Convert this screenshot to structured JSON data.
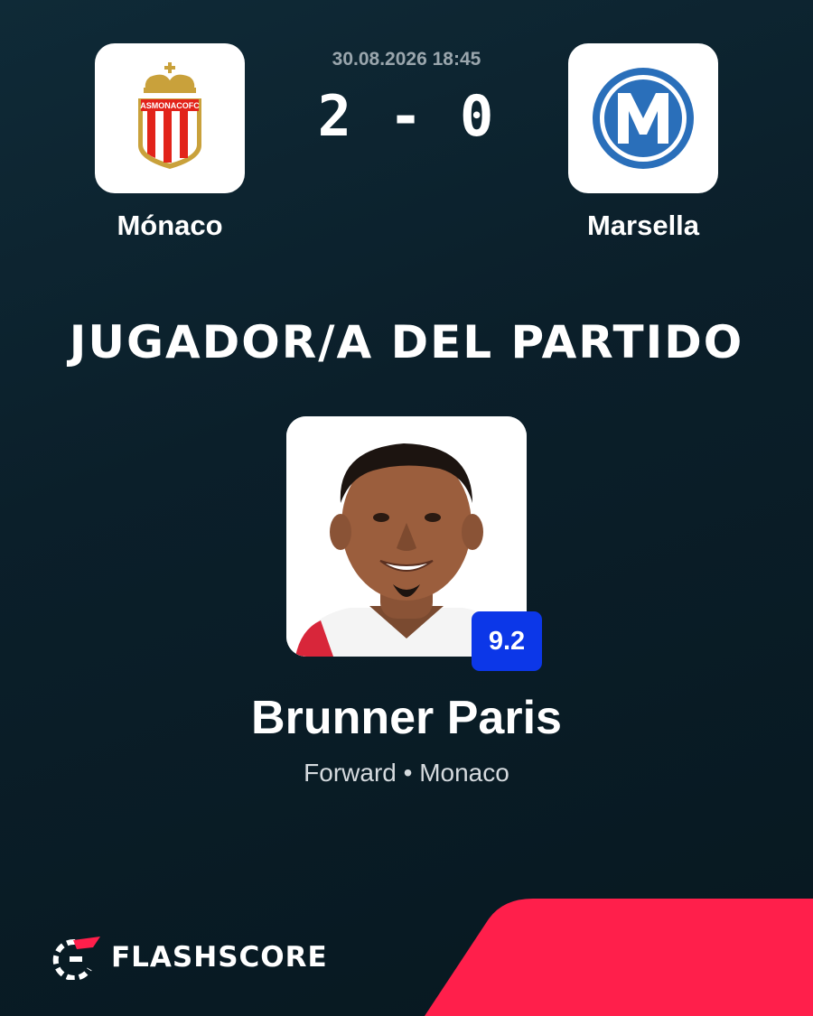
{
  "match": {
    "datetime": "30.08.2026 18:45",
    "score": "2 - 0",
    "home_team": "Mónaco",
    "away_team": "Marsella"
  },
  "home_logo": {
    "crest_text": "ASMONACOFC",
    "colors": {
      "gold": "#c9a13b",
      "red": "#e2231a"
    }
  },
  "away_logo": {
    "crest_text": "M",
    "colors": {
      "blue": "#2a6fba"
    }
  },
  "section_title": "JUGADOR/A DEL PARTIDO",
  "player": {
    "name": "Brunner Paris",
    "meta": "Forward • Monaco",
    "rating": "9.2"
  },
  "brand": {
    "name": "FLASHSCORE",
    "accent_color": "#ff1f4b"
  },
  "colors": {
    "background": "#0b1f2a",
    "rating_badge": "#0c37e8"
  }
}
